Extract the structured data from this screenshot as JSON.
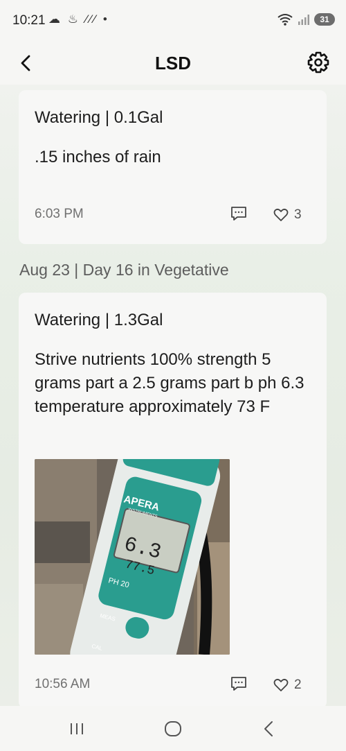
{
  "status_bar": {
    "time": "10:21",
    "notification_icons": "☁ ♨ ⁄⁄⁄ •",
    "wifi_label": "5",
    "battery": "31"
  },
  "header": {
    "title": "LSD",
    "back_icon": "chevron-left-icon",
    "settings_icon": "gear-icon"
  },
  "feed": {
    "entries": [
      {
        "title": "Watering | 0.1Gal",
        "body": ".15 inches of rain",
        "time": "6:03 PM",
        "likes": "3"
      },
      {
        "date_header": "Aug 23 | Day 16 in Vegetative",
        "title": "Watering | 1.3Gal",
        "body": "Strive nutrients 100% strength 5 grams part a 2.5 grams part b ph 6.3 temperature approximately 73 F",
        "photo": {
          "brand": "APERA",
          "brand_sub": "INSTRUMENTS",
          "reading": "6.3",
          "temp_reading": "77.5",
          "model": "PH 20",
          "button_label": "MEAS",
          "button2_label": "CAL"
        },
        "time": "10:56 AM",
        "likes": "2"
      }
    ]
  },
  "colors": {
    "accent_teal": "#2a9d8f",
    "background_green": "#e8eee5"
  }
}
